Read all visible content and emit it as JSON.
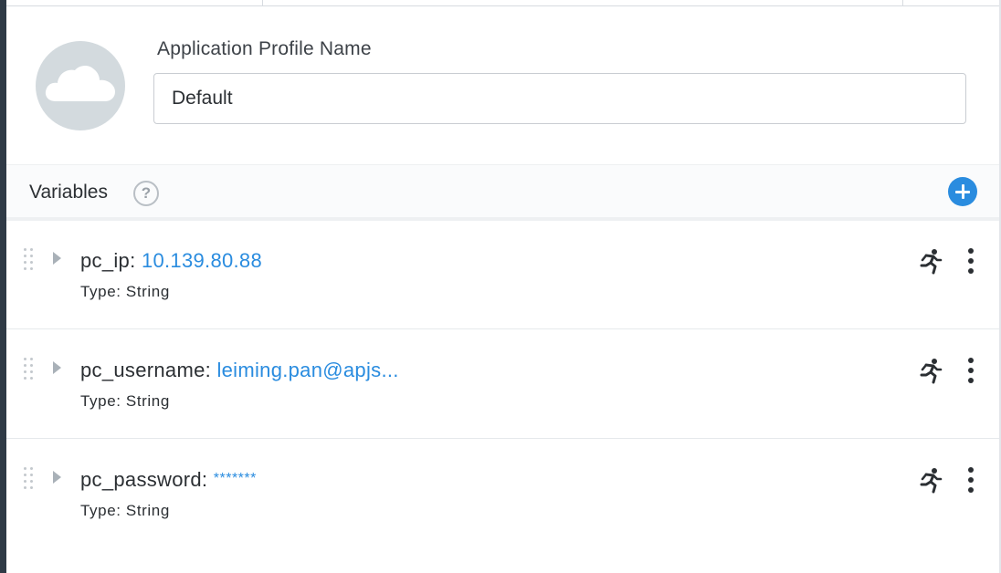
{
  "profile": {
    "label": "Application Profile Name",
    "name_value": "Default",
    "avatar_icon": "cloud-icon"
  },
  "variables": {
    "title": "Variables",
    "help_glyph": "?",
    "accent_color": "#2a8cdf",
    "items": [
      {
        "name": "pc_ip:",
        "value": "10.139.80.88",
        "type": "Type: String"
      },
      {
        "name": "pc_username:",
        "value": "leiming.pan@apjs...",
        "type": "Type: String"
      },
      {
        "name": "pc_password:",
        "value": "*******",
        "type": "Type: String"
      }
    ]
  }
}
